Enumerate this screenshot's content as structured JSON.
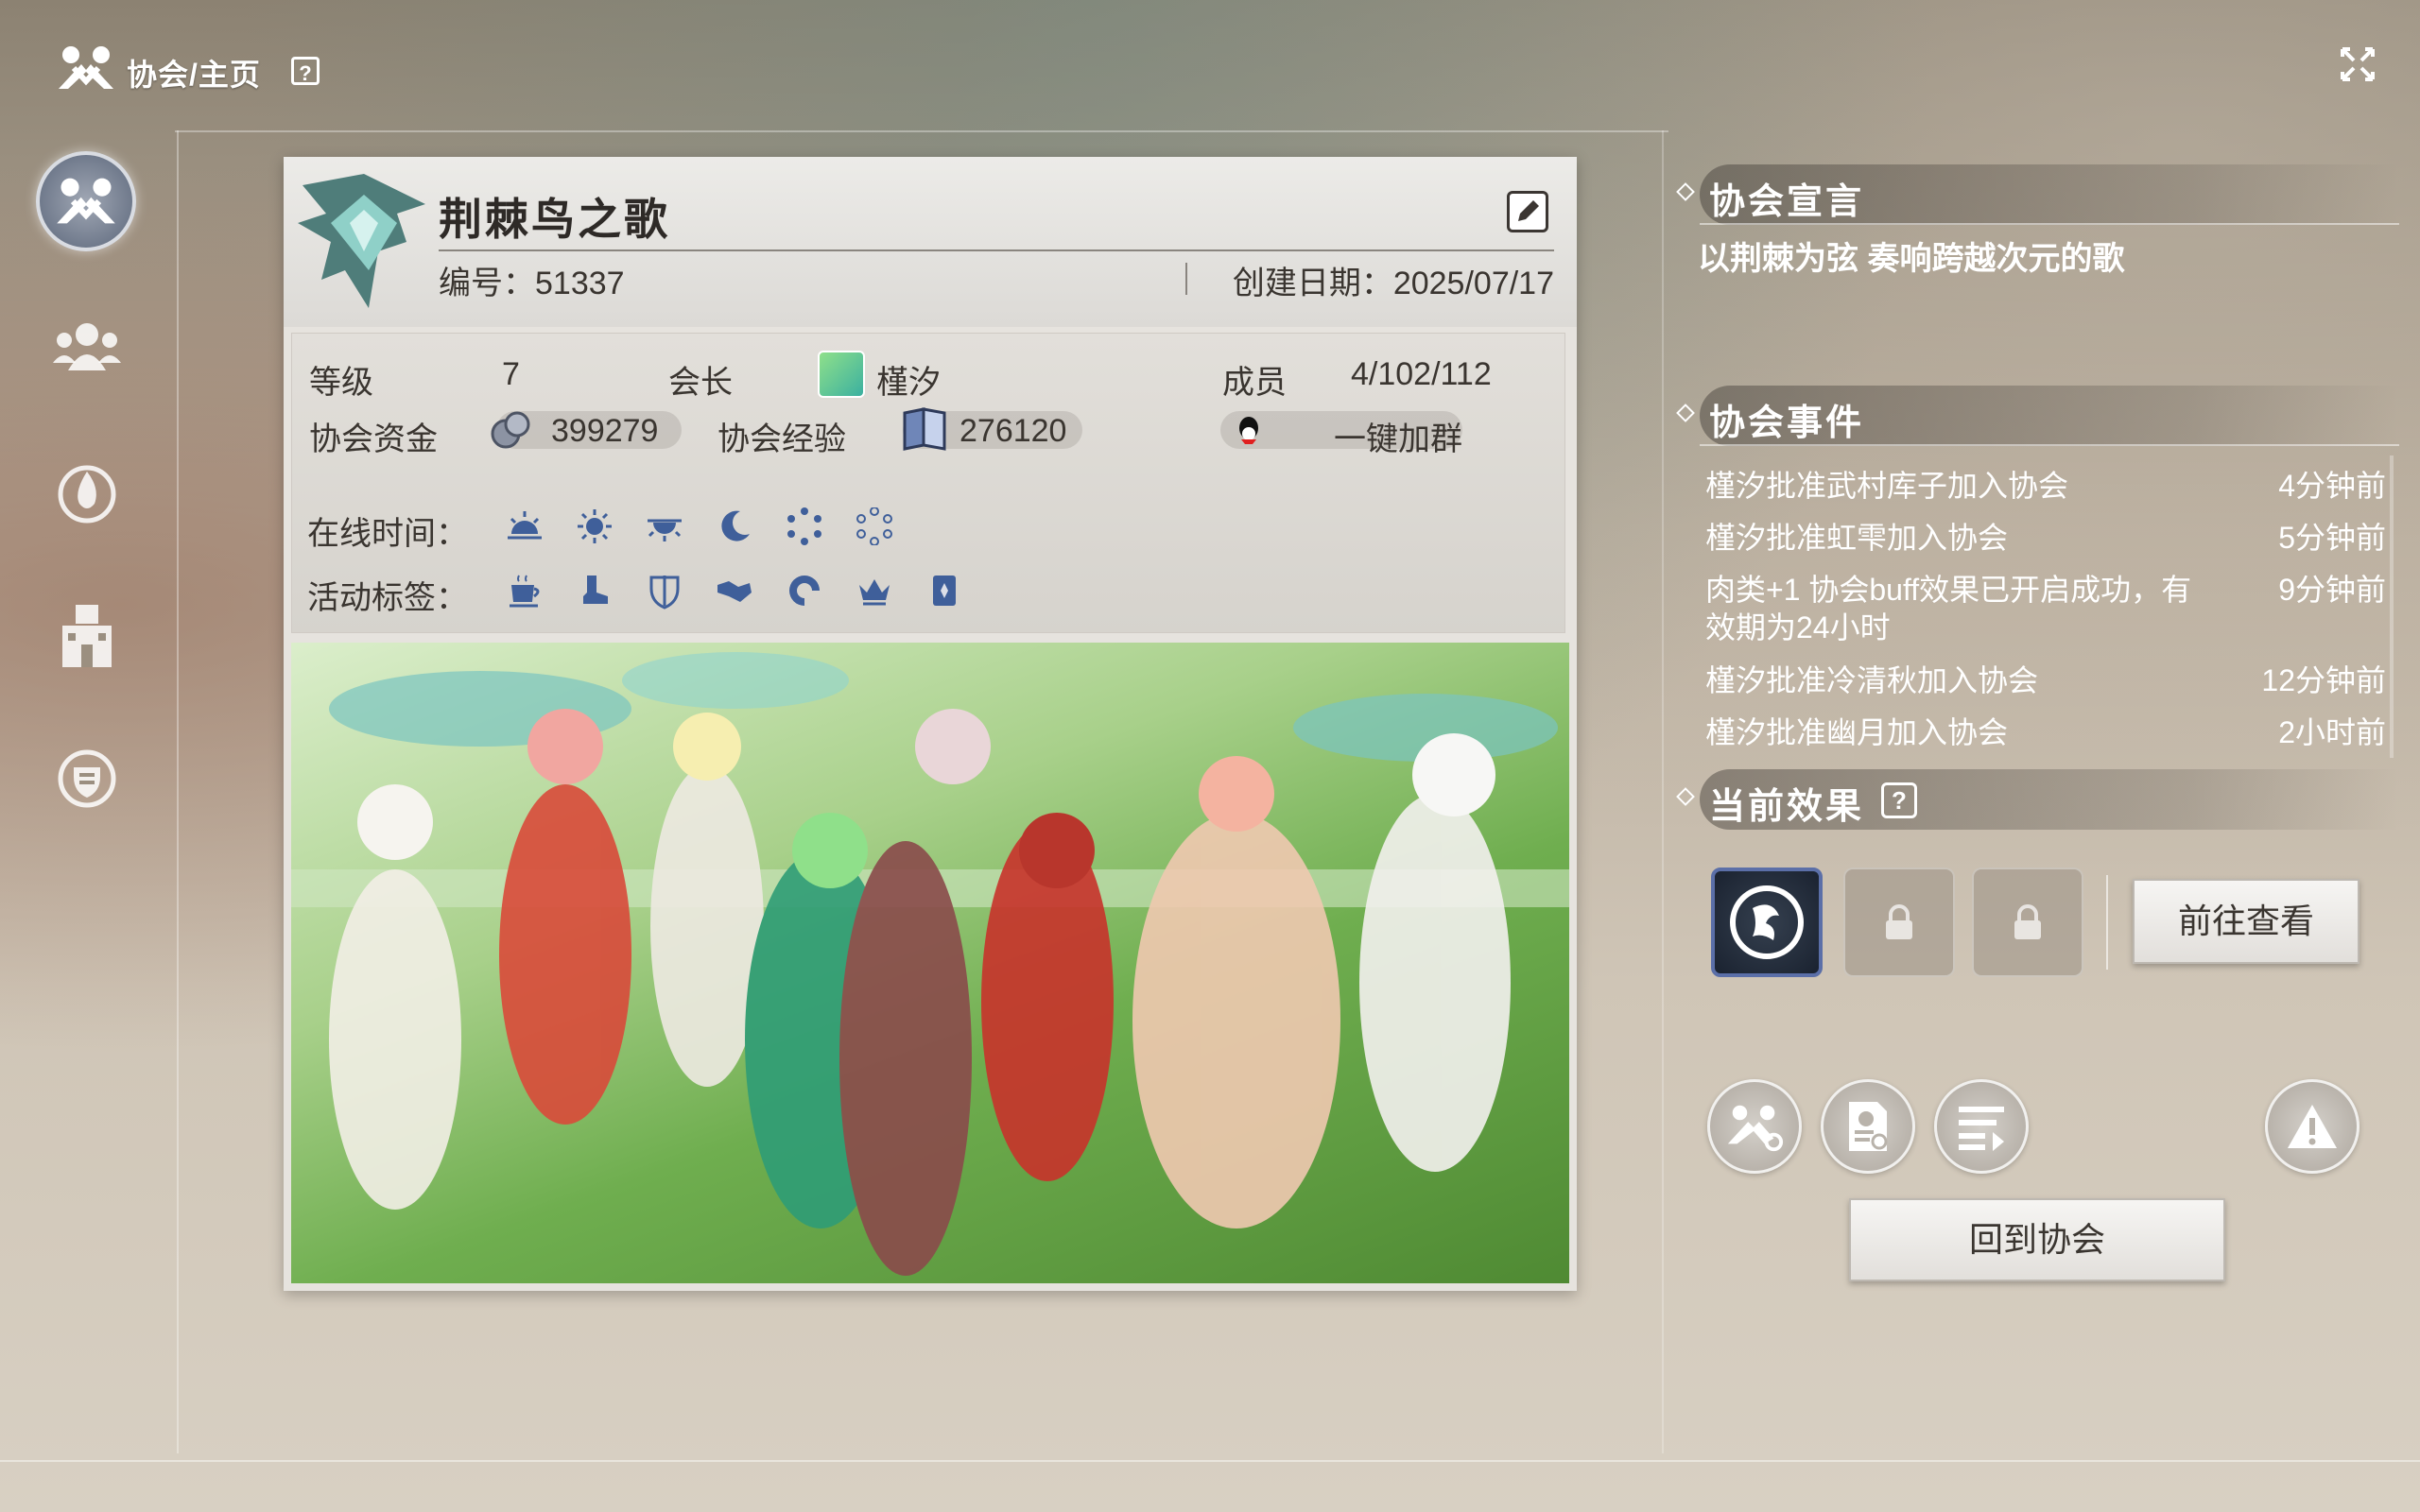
{
  "header": {
    "breadcrumb": "协会/主页",
    "help": "?"
  },
  "guild": {
    "name": "荆棘鸟之歌",
    "id_text": "编号：51337",
    "created_text": "创建日期：2025/07/17",
    "level_label": "等级",
    "level_value": "7",
    "leader_label": "会长",
    "leader_name": "槿汐",
    "members_label": "成员",
    "members_value": "4/102/112",
    "funds_label": "协会资金",
    "funds_value": "399279",
    "exp_label": "协会经验",
    "exp_value": "276120",
    "join_group": "一键加群",
    "online_label": "在线时间：",
    "online_icons": [
      "sunrise-icon",
      "sun-icon",
      "sunset-icon",
      "moon-icon",
      "dots-ring-icon",
      "dots-ring-2-icon"
    ],
    "tags_label": "活动标签：",
    "tag_icons": [
      "cup-icon",
      "boot-icon",
      "shield-sword-icon",
      "handshake-icon",
      "swirl-icon",
      "crown-icon",
      "card-icon"
    ]
  },
  "declaration": {
    "title": "协会宣言",
    "text": "以荆棘为弦 奏响跨越次元的歌"
  },
  "events": {
    "title": "协会事件",
    "items": [
      {
        "text": "槿汐批准武村库子加入协会",
        "time": "4分钟前"
      },
      {
        "text": "槿汐批准虹雫加入协会",
        "time": "5分钟前"
      },
      {
        "text": "肉类+1 协会buff效果已开启成功，有效期为24小时",
        "time": "9分钟前"
      },
      {
        "text": "槿汐批准冷清秋加入协会",
        "time": "12分钟前"
      },
      {
        "text": "槿汐批准幽月加入协会",
        "time": "2小时前"
      }
    ]
  },
  "effects": {
    "title": "当前效果",
    "help": "?",
    "view_button": "前往查看"
  },
  "actions": {
    "return_button": "回到协会"
  },
  "colors": {
    "accent_blue": "#5b6fa8",
    "card_bg": "#e6e3de"
  }
}
